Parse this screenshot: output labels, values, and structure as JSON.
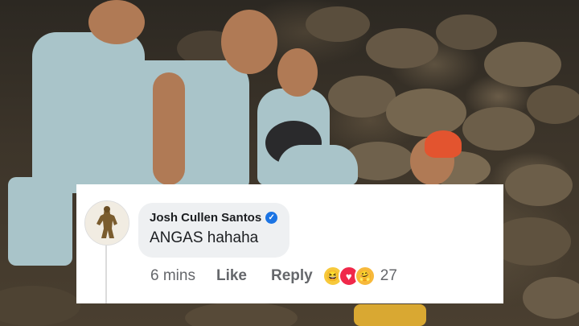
{
  "comment": {
    "author": "Josh Cullen Santos",
    "verified": true,
    "text": "ANGAS hahaha",
    "time": "6 mins",
    "like_label": "Like",
    "reply_label": "Reply",
    "reactions": [
      "haha",
      "love",
      "care"
    ],
    "reaction_count": "27"
  },
  "colors": {
    "card_bg": "#ffffff",
    "bubble_bg": "#eef0f2",
    "verified_badge": "#1b74e4",
    "action_text": "#65676b"
  }
}
